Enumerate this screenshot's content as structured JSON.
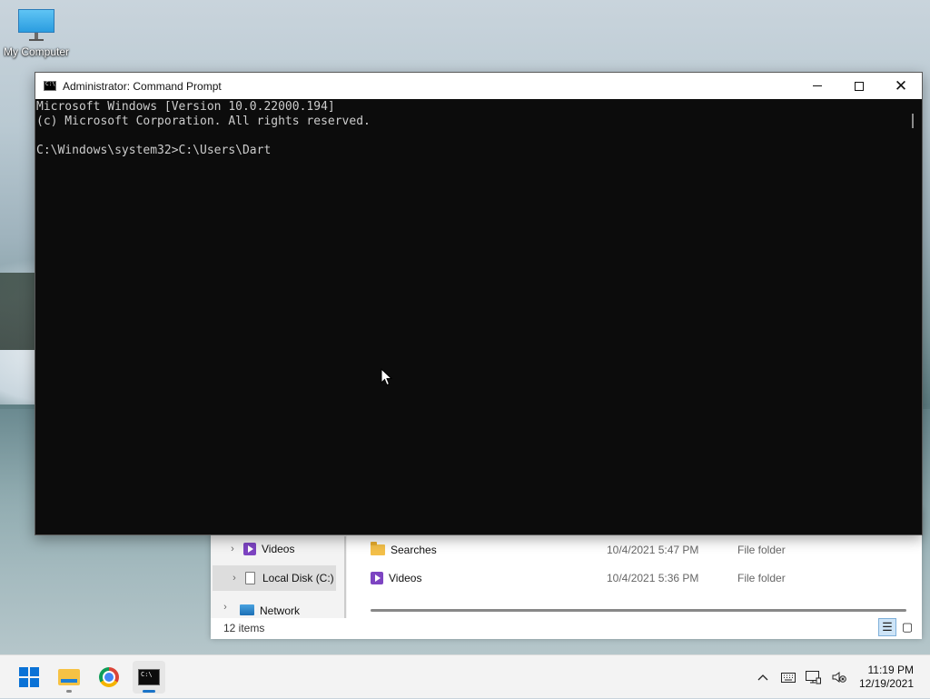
{
  "desktop": {
    "icons": [
      {
        "label": "My Computer",
        "icon": "monitor-icon"
      }
    ]
  },
  "cmd_window": {
    "title": "Administrator: Command Prompt",
    "lines": [
      "Microsoft Windows [Version 10.0.22000.194]",
      "(c) Microsoft Corporation. All rights reserved.",
      "",
      "C:\\Windows\\system32>C:\\Users\\Dart"
    ],
    "controls": {
      "minimize": "minimize-icon",
      "maximize": "maximize-icon",
      "close": "close-icon"
    }
  },
  "explorer": {
    "nav": [
      {
        "label": "Videos",
        "icon": "video-icon",
        "selected": false
      },
      {
        "label": "Local Disk (C:)",
        "icon": "disk-icon",
        "selected": true
      },
      {
        "label": "Network",
        "icon": "network-icon",
        "selected": false
      }
    ],
    "files": [
      {
        "name": "Searches",
        "icon": "folder-icon",
        "date": "10/4/2021 5:47 PM",
        "type": "File folder"
      },
      {
        "name": "Videos",
        "icon": "video-icon",
        "date": "10/4/2021 5:36 PM",
        "type": "File folder"
      }
    ],
    "status": "12 items"
  },
  "taskbar": {
    "apps": [
      {
        "name": "start",
        "icon": "windows-start-icon"
      },
      {
        "name": "file-explorer",
        "icon": "folder-icon"
      },
      {
        "name": "chrome",
        "icon": "chrome-icon"
      },
      {
        "name": "command-prompt",
        "icon": "terminal-icon"
      }
    ],
    "tray": {
      "icons": [
        "chevron-up-icon",
        "keyboard-icon",
        "network-icon",
        "volume-muted-icon"
      ],
      "time": "11:19 PM",
      "date": "12/19/2021"
    }
  },
  "colors": {
    "console_bg": "#0c0c0c",
    "console_fg": "#cccccc",
    "accent": "#0a72d6"
  }
}
